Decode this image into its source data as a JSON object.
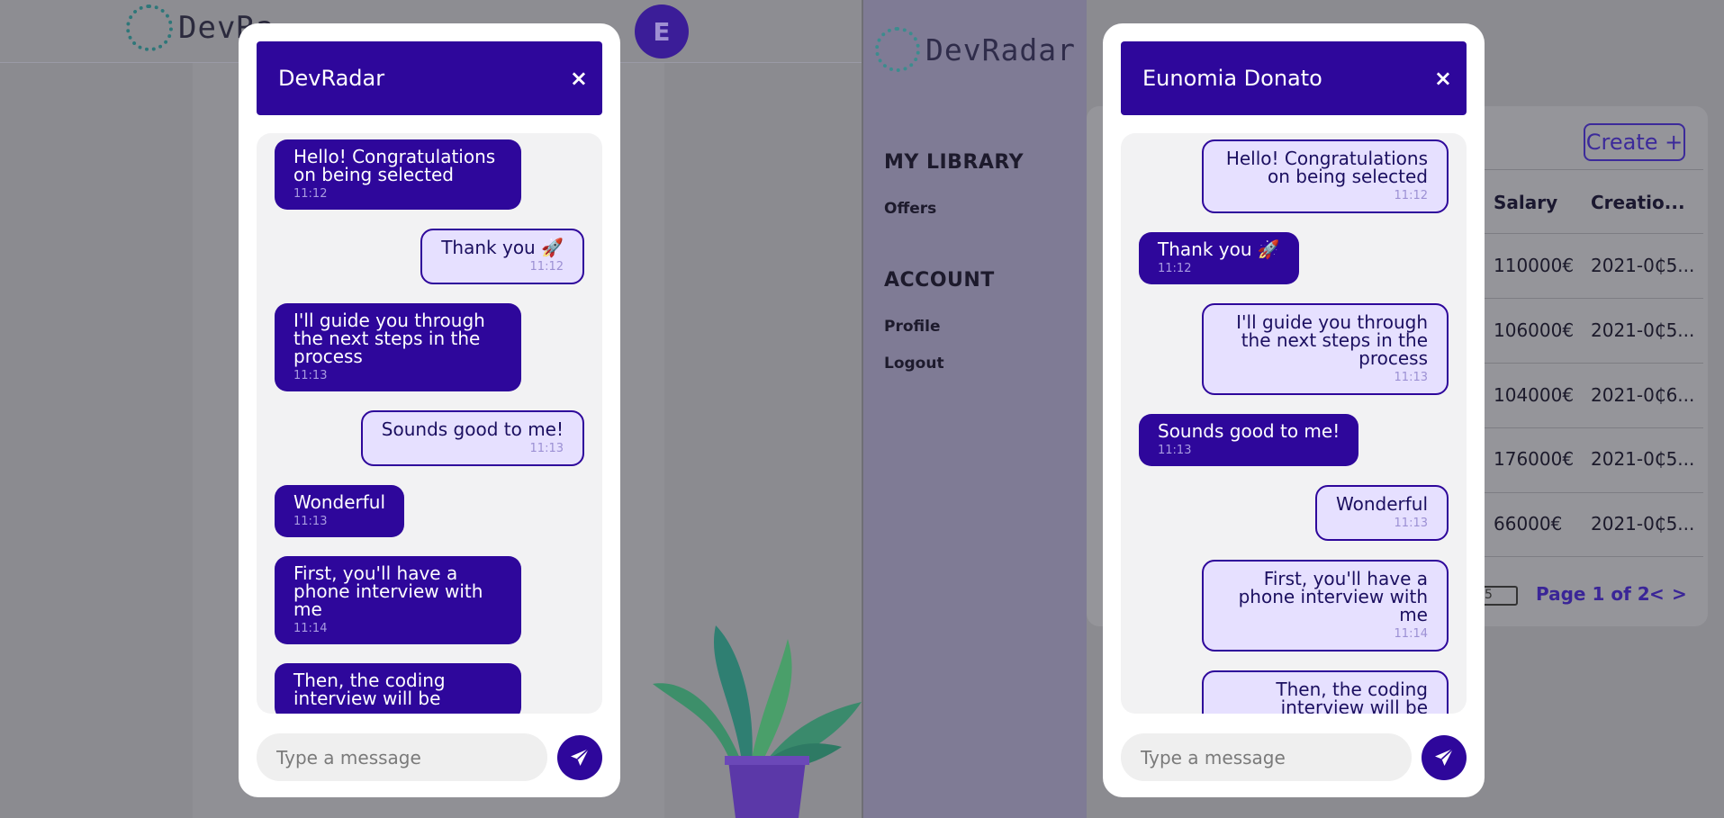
{
  "left_app": {
    "logo_text": "DevRa",
    "avatar_initial": "E"
  },
  "right_app": {
    "logo_text": "DevRadar",
    "sidebar": {
      "section_library": "MY LIBRARY",
      "link_offers": "Offers",
      "section_account": "ACCOUNT",
      "link_profile": "Profile",
      "link_logout": "Logout"
    },
    "table": {
      "create_label": "Create +",
      "columns": [
        "Salary",
        "Creatio..."
      ],
      "rows": [
        {
          "salary": "110000€",
          "created": "2021-0₵5..."
        },
        {
          "salary": "106000€",
          "created": "2021-0₵5..."
        },
        {
          "salary": "104000€",
          "created": "2021-0₵6..."
        },
        {
          "salary": "176000€",
          "created": "2021-0₵5..."
        },
        {
          "salary": "66000€",
          "created": "2021-0₵5..."
        }
      ],
      "page_size_value": "5",
      "pagination_label": "Page 1 of 2",
      "prev_label": "<",
      "next_label": ">"
    }
  },
  "chat_left": {
    "title": "DevRadar",
    "close_label": "×",
    "placeholder": "Type a message",
    "messages": [
      {
        "text": "Hello! Congratulations on being selected",
        "time": "11:12"
      },
      {
        "text": "Thank you 🚀",
        "time": "11:12"
      },
      {
        "text": "I'll guide you through the next steps in the process",
        "time": "11:13"
      },
      {
        "text": "Sounds good to me!",
        "time": "11:13"
      },
      {
        "text": "Wonderful",
        "time": "11:13"
      },
      {
        "text": "First, you'll have a phone interview with me",
        "time": "11:14"
      },
      {
        "text": "Then, the coding interview will be",
        "time": ""
      }
    ]
  },
  "chat_right": {
    "title": "Eunomia Donato",
    "close_label": "×",
    "placeholder": "Type a message",
    "messages": [
      {
        "text": "Hello! Congratulations on being selected",
        "time": "11:12"
      },
      {
        "text": "Thank you 🚀",
        "time": "11:12"
      },
      {
        "text": "I'll guide you through the next steps in the process",
        "time": "11:13"
      },
      {
        "text": "Sounds good to me!",
        "time": "11:13"
      },
      {
        "text": "Wonderful",
        "time": "11:13"
      },
      {
        "text": "First, you'll have a phone interview with me",
        "time": "11:14"
      },
      {
        "text": "Then, the coding interview will be",
        "time": ""
      }
    ]
  },
  "colors": {
    "brand_primary": "#2e079b",
    "bubble_incoming_bg": "#e6e0ff",
    "backdrop": "#8b8b90"
  }
}
